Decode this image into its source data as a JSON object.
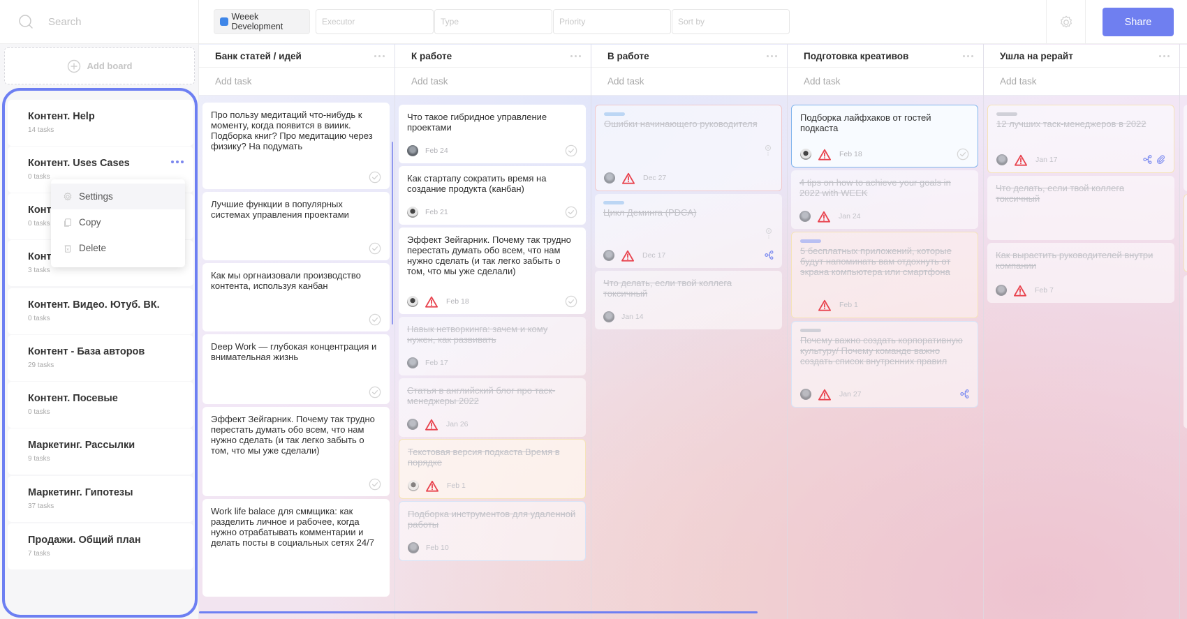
{
  "sidebar": {
    "search_placeholder": "Search",
    "add_board_label": "Add board",
    "boards": [
      {
        "name": "Контент. Help",
        "count": "14 tasks"
      },
      {
        "name": "Контент. Uses Cases",
        "count": "0 tasks"
      },
      {
        "name": "Контент. Соцсети",
        "count": "0 tasks"
      },
      {
        "name": "Контент. Партнерства",
        "count": "3 tasks"
      },
      {
        "name": "Контент. Видео. Ютуб. ВК.",
        "count": "0 tasks"
      },
      {
        "name": "Контент - База авторов",
        "count": "29 tasks"
      },
      {
        "name": "Контент. Посевые",
        "count": "0 tasks"
      },
      {
        "name": "Маркетинг. Рассылки",
        "count": "9 tasks"
      },
      {
        "name": "Маркетинг. Гипотезы",
        "count": "37 tasks"
      },
      {
        "name": "Продажи. Общий план",
        "count": "7 tasks"
      }
    ],
    "context_menu": {
      "items": [
        {
          "label": "Settings",
          "icon": "gear-icon"
        },
        {
          "label": "Copy",
          "icon": "copy-icon"
        },
        {
          "label": "Delete",
          "icon": "trash-icon"
        }
      ]
    }
  },
  "topbar": {
    "project": {
      "label": "Weeek Development",
      "color": "#3f86e8"
    },
    "filters": [
      {
        "placeholder": "Executor"
      },
      {
        "placeholder": "Type"
      },
      {
        "placeholder": "Priority"
      },
      {
        "placeholder": "Sort by"
      }
    ],
    "settings_icon": "gear-icon",
    "share_label": "Share"
  },
  "colors": {
    "accent": "#6f7ff0",
    "warning": "#e8424d",
    "link_icon": "#7d8cf0"
  },
  "columns": [
    {
      "title": "Банк статей / идей",
      "add_task": "Add task",
      "cards": [
        {
          "title": "Про пользу медитаций что-нибудь к моменту, когда появится в вииик. Подборка книг? Про медитацию через физику? На подумать",
          "done": false
        },
        {
          "title": "Лучшие функции в популярных системах управления проектами",
          "done": false
        },
        {
          "title": "Как мы оргнаизовали производство контента, используя канбан",
          "done": false
        },
        {
          "title": "Deep Work — глубокая концентрация и внимательная жизнь",
          "done": false
        },
        {
          "title": "Эффект Зейгарник. Почему так трудно перестать думать обо всем, что нам нужно сделать (и так легко забыть о том, что мы уже сделали)",
          "done": false
        },
        {
          "title": "Work life balace для сммщика: как разделить личное и рабочее, когда нужно отрабатывать комментарии и делать посты в социальных сетях 24/7",
          "done": false
        }
      ]
    },
    {
      "title": "К работе",
      "add_task": "Add task",
      "cards": [
        {
          "title": "Что такое гибридное управление проектами",
          "date": "Feb 24",
          "done": false,
          "overdue": false
        },
        {
          "title": "Как стартапу сократить время на создание продукта (канбан)",
          "date": "Feb 21",
          "done": false,
          "overdue": false
        },
        {
          "title": "Эффект Зейгарник. Почему так трудно перестать думать обо всем, что нам нужно сделать (и так легко забыть о том, что мы уже сделали)",
          "date": "Feb 18",
          "done": false,
          "overdue": true
        },
        {
          "title": "Навык нетворкинга: зачем и кому нужен, как развивать",
          "date": "Feb 17",
          "done": true,
          "overdue": false
        },
        {
          "title": "Статья в английский блог про таск-менеджеры 2022",
          "date": "Jan 26",
          "done": true,
          "overdue": true
        },
        {
          "title": "Текстовая версия подкаста Время в порядке",
          "date": "Feb 1",
          "done": true,
          "overdue": true
        },
        {
          "title": "Подборка инструментов для удаленной работы",
          "date": "Feb 10",
          "done": true,
          "overdue": false
        }
      ]
    },
    {
      "title": "В работе",
      "add_task": "Add task",
      "cards": [
        {
          "title": "Ошибки начинающего руководителя",
          "date": "Dec 27",
          "done": true,
          "overdue": true
        },
        {
          "title": "Цикл Деминга (PDCA)",
          "date": "Dec 17",
          "done": true,
          "overdue": true
        },
        {
          "title": "Что делать, если твой коллега токсичный",
          "date": "Jan 14",
          "done": true,
          "overdue": false
        }
      ]
    },
    {
      "title": "Подготовка креативов",
      "add_task": "Add task",
      "cards": [
        {
          "title": "Подборка лайфхаков от гостей подкаста",
          "date": "Feb 18",
          "done": false,
          "overdue": true
        },
        {
          "title": "4 tips on how to achieve your goals in 2022 with WEEK",
          "date": "Jan 24",
          "done": true,
          "overdue": true
        },
        {
          "title": "5 бесплатных приложений, которые будут напоминать вам отдохнуть от экрана компьютера или смартфона",
          "date": "Feb 1",
          "done": true,
          "overdue": true
        },
        {
          "title": "Почему важно создать корпоративную культуру/ Почему команде важно создать список внутренних правил",
          "date": "Jan 27",
          "done": true,
          "overdue": true
        }
      ]
    },
    {
      "title": "Ушла на рерайт",
      "add_task": "Add task",
      "cards": [
        {
          "title": "12 лучших таск-менеджеров в 2022",
          "date": "Jan 17",
          "done": true,
          "overdue": true
        },
        {
          "title": "Что делать, если твой коллега токсичный",
          "done": true
        },
        {
          "title": "Как вырастить руководителей внутри компании",
          "date": "Feb 7",
          "done": true,
          "overdue": true
        }
      ]
    }
  ]
}
